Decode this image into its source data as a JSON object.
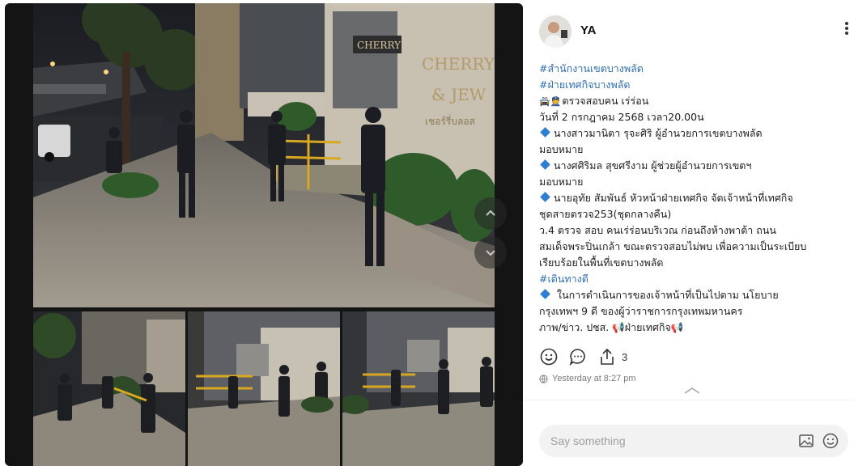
{
  "author": {
    "name": "YA"
  },
  "post": {
    "lines": [
      {
        "kind": "tag",
        "text": "#สำนักงานเขตบางพลัด"
      },
      {
        "kind": "tag",
        "text": "#ฝ่ายเทศกิจบางพลัด"
      },
      {
        "kind": "emoji",
        "emoji": "🚔👮",
        "text": "ตรวจสอบคน เร่ร่อน"
      },
      {
        "kind": "plain",
        "text": "วันที่ 2 กรกฎาคม 2568  เวลา20.00น"
      },
      {
        "kind": "bullet",
        "text": "นางสาวมานิตา รุจะศิริ ผู้อำนวยการเขตบางพลัด"
      },
      {
        "kind": "plain",
        "text": "มอบหมาย"
      },
      {
        "kind": "bullet",
        "text": "นางศศิริมล สุขศรีงาม ผู้ช่วยผู้อำนวยการเขตฯ"
      },
      {
        "kind": "plain",
        "text": "มอบหมาย"
      },
      {
        "kind": "bullet",
        "text": "นายอุทัย สัมพันธ์ หัวหน้าฝ่ายเทศกิจ  จัดเจ้าหน้าที่เทศกิจ"
      },
      {
        "kind": "plain",
        "text": "ชุดสายตรวจ253(ชุดกลางคืน)"
      },
      {
        "kind": "plain",
        "text": "ว.4 ตรวจ สอบ คนเร่ร่อนบริเวณ ก่อนถึงห้างพาต้า ถนน"
      },
      {
        "kind": "plain",
        "text": "สมเด็จพระปิ่นเกล้า ขณะตรวจสอบไม่พบ เพื่อความเป็นระเบียบ"
      },
      {
        "kind": "plain",
        "text": "เรียบร้อยในพื้นที่เขตบางพลัด"
      },
      {
        "kind": "tag",
        "text": " #เดินทางดี"
      },
      {
        "kind": "bullet",
        "text": " ในการดำเนินการของเจ้าหน้าที่เป็นไปตาม  นโยบาย"
      },
      {
        "kind": "plain",
        "text": "กรุงเทพฯ 9 ดี  ของผู้ว่าราชการกรุงเทพมหานคร"
      },
      {
        "kind": "plain",
        "text": "ภาพ/ข่าว. ปชส. 📢ฝ่ายเทศกิจ📢"
      }
    ]
  },
  "actions": {
    "share_count": "3"
  },
  "timestamp": "Yesterday at 8:27 pm",
  "comment": {
    "placeholder": "Say something"
  },
  "images": {
    "main_sign_1": "CHERRY",
    "main_sign_2": "CHERRY",
    "main_sign_3": "& JEW",
    "main_sign_4": "เชอร์รี่บลอส"
  },
  "icons": {
    "more": "more-vertical-icon",
    "like": "smiley-icon",
    "comment": "comment-bubble-icon",
    "share": "share-upload-icon",
    "globe": "globe-icon",
    "collapse": "chevron-up-icon",
    "image": "image-icon",
    "emoji": "emoji-icon"
  },
  "colors": {
    "tag": "#2f6fb4",
    "bullet": "#2f7fd1",
    "viewer_bg": "#141414"
  }
}
